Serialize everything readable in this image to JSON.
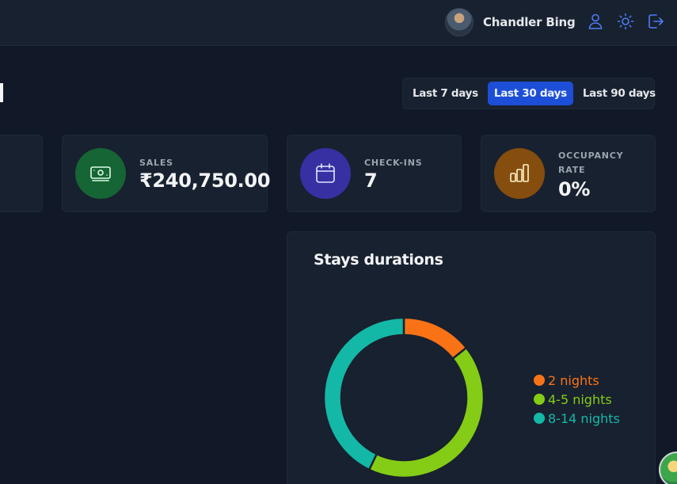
{
  "header": {
    "user_name": "Chandler Bing",
    "icons": [
      "user-icon",
      "sun-icon",
      "logout-icon"
    ]
  },
  "filters": {
    "options": [
      "Last 7 days",
      "Last 30 days",
      "Last 90 days"
    ],
    "selected": "Last 30 days"
  },
  "stats": [
    {
      "label": "SALES",
      "value": "₹240,750.00",
      "icon": "banknote-icon",
      "color": "#166534"
    },
    {
      "label": "CHECK-INS",
      "value": "7",
      "icon": "calendar-icon",
      "color": "#3730a3"
    },
    {
      "label_line1": "OCCUPANCY",
      "label_line2": "RATE",
      "value": "0%",
      "icon": "chart-bars-icon",
      "color": "#854d0e"
    }
  ],
  "chart": {
    "title": "Stays durations"
  },
  "chart_data": {
    "type": "pie",
    "categories": [
      "2 nights",
      "4-5 nights",
      "8-14 nights"
    ],
    "values": [
      1,
      3,
      3
    ],
    "colors": [
      "#f97316",
      "#84cc16",
      "#14b8a6"
    ],
    "donut": true,
    "legend": "right"
  }
}
